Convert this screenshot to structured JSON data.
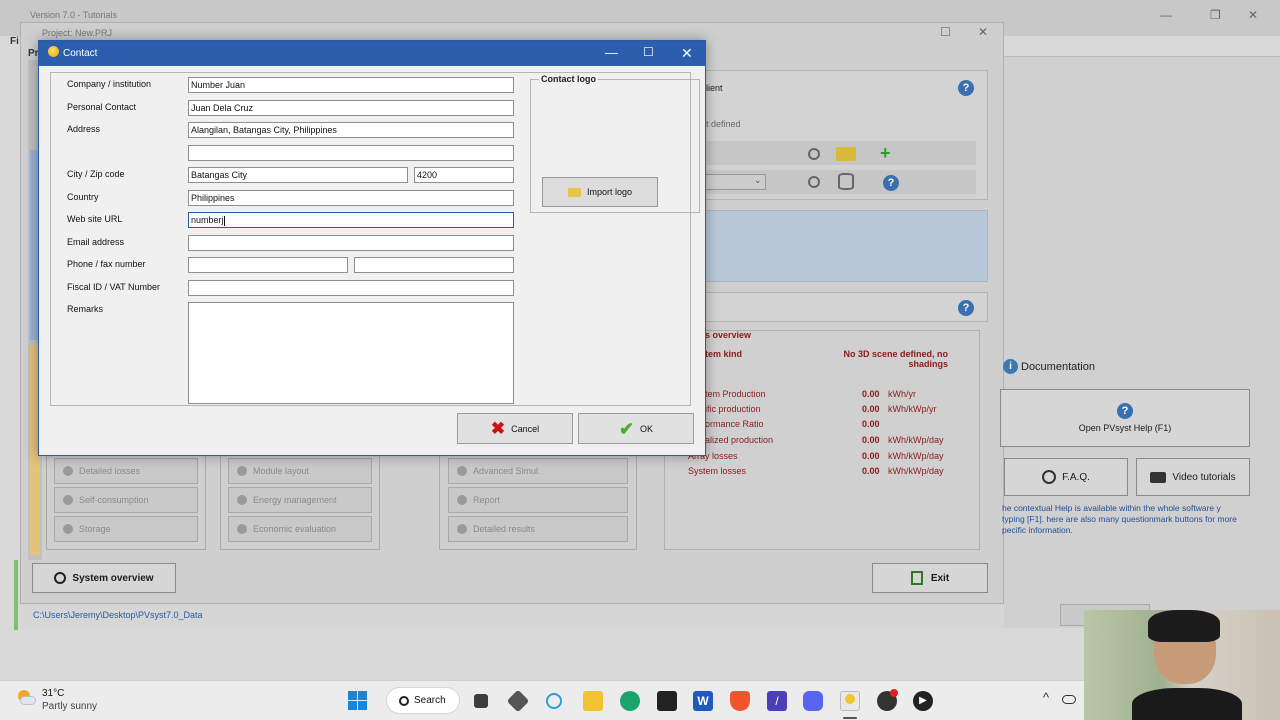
{
  "outer_window": {
    "title": "Version 7.0 - Tutorials",
    "project_title": "Project: New.PRJ",
    "menu_fi": "Fi",
    "menu_pr": "Pr"
  },
  "background": {
    "client_label": "lient",
    "not_defined": "t defined",
    "systems_overview_title": "s overview",
    "system_kind_label": "tem kind",
    "no_3d_scene": "No 3D scene defined, no shadings",
    "results": [
      {
        "label": "tem Production",
        "value": "0.00",
        "unit": "kWh/yr"
      },
      {
        "label": "ific production",
        "value": "0.00",
        "unit": "kWh/kWp/yr"
      },
      {
        "label": "ormance Ratio",
        "value": "0.00",
        "unit": ""
      },
      {
        "label": "alized production",
        "value": "0.00",
        "unit": "kWh/kWp/day"
      },
      {
        "label": "Array losses",
        "value": "0.00",
        "unit": "kWh/kWp/day"
      },
      {
        "label": "System losses",
        "value": "0.00",
        "unit": "kWh/kWp/day"
      }
    ],
    "col1_buttons": [
      "Detailed losses",
      "Self-consumption",
      "Storage"
    ],
    "col2_buttons": [
      "Module layout",
      "Energy management",
      "Economic evaluation"
    ],
    "col3_buttons": [
      "Advanced Simul.",
      "Report",
      "Detailed results"
    ],
    "system_overview_button": "System overview",
    "exit_button": "Exit",
    "data_path": "C:\\Users\\Jeremy\\Desktop\\PVsyst7.0_Data",
    "documentation_title": "Documentation",
    "help_button": "Open PVsyst Help (F1)",
    "faq_button": "F.A.Q.",
    "video_button": "Video tutorials",
    "help_text": "he contextual Help is available within the whole software y typing [F1]. here are also many questionmark buttons for more pecific information."
  },
  "dialog": {
    "title": "Contact",
    "fields": {
      "company_label": "Company / institution",
      "company_value": "Number Juan",
      "personal_label": "Personal Contact",
      "personal_value": "Juan Dela Cruz",
      "address_label": "Address",
      "address_value": "Alangilan, Batangas City, Philippines",
      "address2_value": "",
      "city_label": "City / Zip code",
      "city_value": "Batangas City",
      "zip_value": "4200",
      "country_label": "Country",
      "country_value": "Philippines",
      "website_label": "Web site URL",
      "website_value": "numberj",
      "email_label": "Email address",
      "email_value": "",
      "phone_label": "Phone / fax number",
      "phone_value": "",
      "fax_value": "",
      "fiscal_label": "Fiscal ID / VAT Number",
      "fiscal_value": "",
      "remarks_label": "Remarks",
      "remarks_value": ""
    },
    "logo_caption": "Contact logo",
    "import_logo_button": "Import logo",
    "cancel_button": "Cancel",
    "ok_button": "OK"
  },
  "taskbar": {
    "temperature": "31°C",
    "weather": "Partly sunny",
    "search_label": "Search"
  },
  "colors": {
    "dialog_titlebar": "#2b5fad",
    "cancel_red": "#d01010",
    "ok_green": "#4caf2a",
    "results_red": "#8b1a1a"
  }
}
